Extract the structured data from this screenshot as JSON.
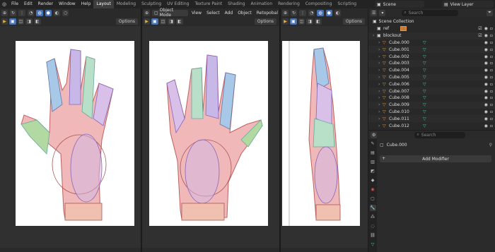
{
  "topbar": {
    "menus": [
      "File",
      "Edit",
      "Render",
      "Window",
      "Help"
    ],
    "workspaces": [
      "Layout",
      "Modeling",
      "Sculpting",
      "UV Editing",
      "Texture Paint",
      "Shading",
      "Animation",
      "Rendering",
      "Compositing",
      "Scripting"
    ],
    "active_workspace": "Layout",
    "scene": "Scene",
    "view_layer": "View Layer"
  },
  "viewport_left": {
    "options_label": "Options"
  },
  "viewport_mid": {
    "mode": "Object Mode",
    "menus": [
      "View",
      "Select",
      "Add",
      "Object"
    ],
    "transform": "Retopobal",
    "options_label": "Options"
  },
  "viewport_right": {
    "options_label": "Options"
  },
  "outliner": {
    "search_placeholder": "Search",
    "scene_collection": "Scene Collection",
    "items": [
      {
        "name": "ref",
        "type": "image"
      },
      {
        "name": "blockout",
        "type": "collection"
      },
      {
        "name": "Cube.000",
        "type": "mesh"
      },
      {
        "name": "Cube.001",
        "type": "mesh"
      },
      {
        "name": "Cube.002",
        "type": "mesh"
      },
      {
        "name": "Cube.003",
        "type": "mesh"
      },
      {
        "name": "Cube.004",
        "type": "mesh"
      },
      {
        "name": "Cube.005",
        "type": "mesh"
      },
      {
        "name": "Cube.006",
        "type": "mesh"
      },
      {
        "name": "Cube.007",
        "type": "mesh"
      },
      {
        "name": "Cube.008",
        "type": "mesh"
      },
      {
        "name": "Cube.009",
        "type": "mesh"
      },
      {
        "name": "Cube.010",
        "type": "mesh"
      },
      {
        "name": "Cube.011",
        "type": "mesh"
      },
      {
        "name": "Cube.012",
        "type": "mesh"
      }
    ]
  },
  "properties": {
    "search_placeholder": "Search",
    "object_name": "Cube.000",
    "add_modifier_label": "Add Modifier"
  },
  "colors": {
    "accent_blue": "#4772b3",
    "mesh_orange": "#e9973a",
    "mesh_green": "#4ec9a4"
  }
}
